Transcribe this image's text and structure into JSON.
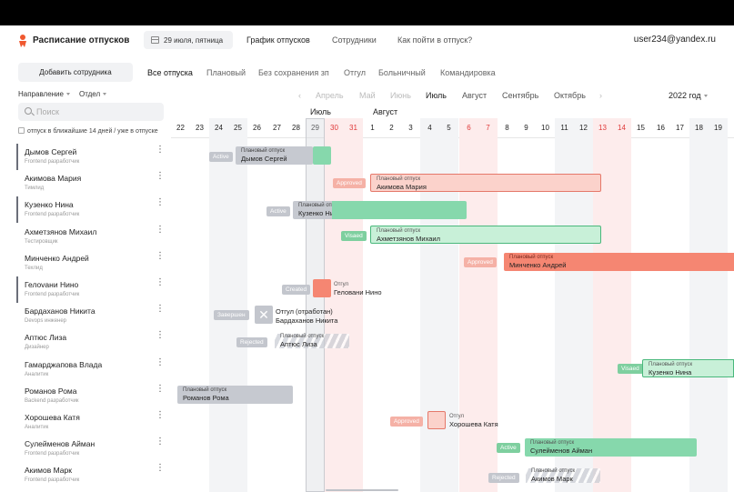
{
  "header": {
    "app_title": "Расписание отпусков",
    "date_chip": "29 июля, пятница",
    "nav": [
      "График отпусков",
      "Сотрудники",
      "Как пойти в отпуск?"
    ],
    "user_email": "user234@yandex.ru"
  },
  "toolbar": {
    "add_button": "Добавить сотрудника",
    "filters": [
      "Все отпуска",
      "Плановый",
      "Без сохранения зп",
      "Отгул",
      "Больничный",
      "Командировка"
    ]
  },
  "sidebar": {
    "direction_select": "Направление",
    "department_select": "Отдел",
    "search_placeholder": "Поиск",
    "checkbox_label": "отпуск в ближайшие 14 дней / уже в отпуске"
  },
  "month_nav": {
    "months": [
      "Апрель",
      "Май",
      "Июнь",
      "Июль",
      "Август",
      "Сентябрь",
      "Октябрь"
    ],
    "year": "2022 год",
    "prev_arrow": "‹",
    "next_arrow": "›"
  },
  "calendar": {
    "month_labels": [
      "Июль",
      "Август"
    ],
    "days": [
      "22",
      "23",
      "24",
      "25",
      "26",
      "27",
      "28",
      "29",
      "30",
      "31",
      "1",
      "2",
      "3",
      "4",
      "5",
      "6",
      "7",
      "8",
      "9",
      "10",
      "11",
      "12",
      "13",
      "14",
      "15",
      "16",
      "17",
      "18",
      "19"
    ]
  },
  "employees": [
    {
      "name": "Дымов Сергей",
      "role": "Frontend разработчик"
    },
    {
      "name": "Акимова Мария",
      "role": "Тимлид"
    },
    {
      "name": "Кузенко Нина",
      "role": "Frontend разработчик"
    },
    {
      "name": "Ахметзянов Михаил",
      "role": "Тестировщик"
    },
    {
      "name": "Минченко Андрей",
      "role": "Техлид"
    },
    {
      "name": "Гелovани Нино",
      "role": "Frontend разработчик"
    },
    {
      "name": "Бардаханов Никита",
      "role": "Devops инженер"
    },
    {
      "name": "Аптюс Лиза",
      "role": "Дизайнер"
    },
    {
      "name": "Гамарджапова Влада",
      "role": "Аналитик"
    },
    {
      "name": "Романов Рома",
      "role": "Backend разработчик"
    },
    {
      "name": "Хорошева Катя",
      "role": "Аналитик"
    },
    {
      "name": "Сулейменов Айман",
      "role": "Frontend разработчик"
    },
    {
      "name": "Акимов Марк",
      "role": "Frontend разработчик"
    }
  ],
  "more_glyph": "⋮",
  "events": {
    "e1": {
      "status": "Active",
      "type": "Плановый отпуск",
      "name": "Дымов Сергей"
    },
    "e2": {
      "status": "Approved",
      "type": "Плановый отпуск",
      "name": "Акимова Мария"
    },
    "e3": {
      "status": "Active",
      "type": "Плановый отпуск",
      "name": "Кузенко Нина"
    },
    "e4": {
      "status": "Visaed",
      "type": "Плановый отпуск",
      "name": "Ахметзянов Михаил"
    },
    "e5": {
      "status": "Approved",
      "type": "Плановый отпуск",
      "name": "Минченко Андрей"
    },
    "e6": {
      "status": "Created",
      "type": "Отгул",
      "name": "Геловани Нино"
    },
    "e7": {
      "status": "Завершен",
      "type": "Отгул (отработан)",
      "name": "Бардаханов Никита",
      "glyph": "✕"
    },
    "e8": {
      "status": "Rejected",
      "type": "Плановый отпуск",
      "name": "Аптюс Лиза"
    },
    "e9": {
      "status": "Visaed",
      "type": "Плановый отпуск",
      "name": "Кузенко Нина"
    },
    "e10": {
      "type": "Плановый отпуск",
      "name": "Романов Рома"
    },
    "e11": {
      "status": "Approved",
      "type": "Отгул",
      "name": "Хорошева Катя"
    },
    "e12": {
      "status": "Active",
      "type": "Плановый отпуск",
      "name": "Сулейменов Айман"
    },
    "e13": {
      "status": "Rejected",
      "type": "Плановый отпуск",
      "name": "Акимов Марк"
    }
  }
}
